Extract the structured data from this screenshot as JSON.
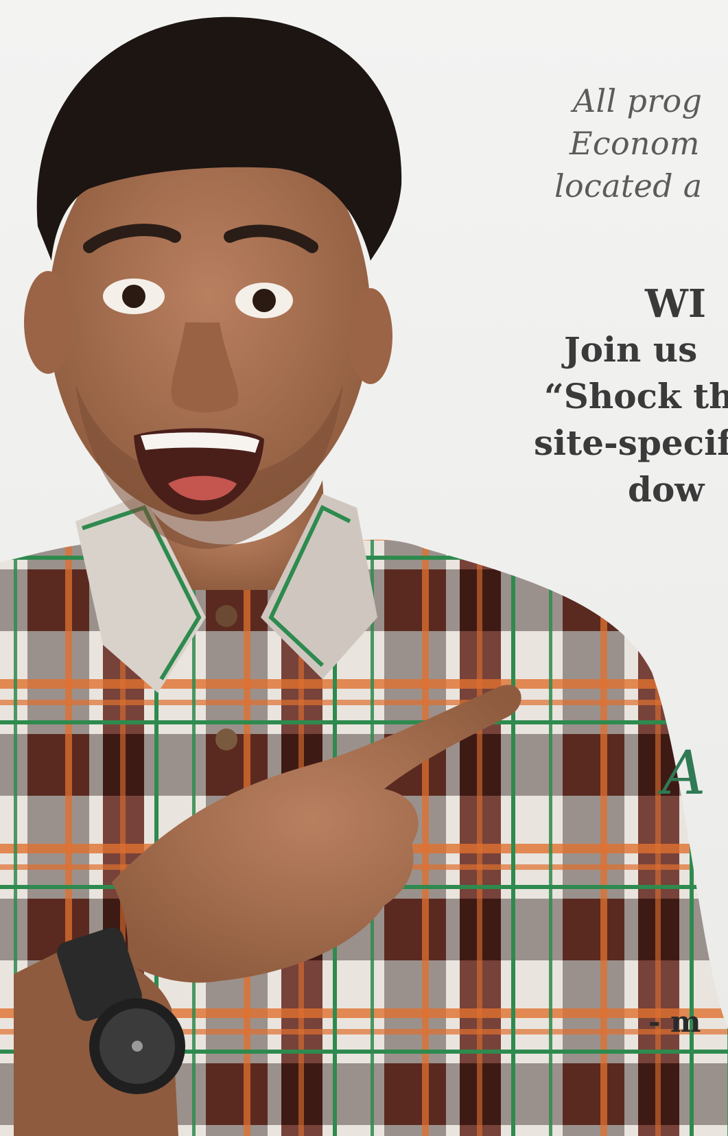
{
  "flyer": {
    "intro_lines": [
      "All prog",
      "Econom",
      "located a"
    ],
    "headline": "WI",
    "body_lines": [
      "Join us ",
      "“Shock th",
      "site-specif",
      "dow"
    ],
    "script_letter": "A",
    "signature": "- m"
  },
  "colors": {
    "background": "#f1f1f0",
    "italic_text": "#5b5b5b",
    "bold_text": "#3a3a3a",
    "accent_green": "#2f7a55",
    "shirt_dark": "#5a2a20",
    "shirt_orange": "#e0702f",
    "shirt_green": "#2e8a4e",
    "skin": "#a8704d",
    "hair": "#1c1512"
  }
}
